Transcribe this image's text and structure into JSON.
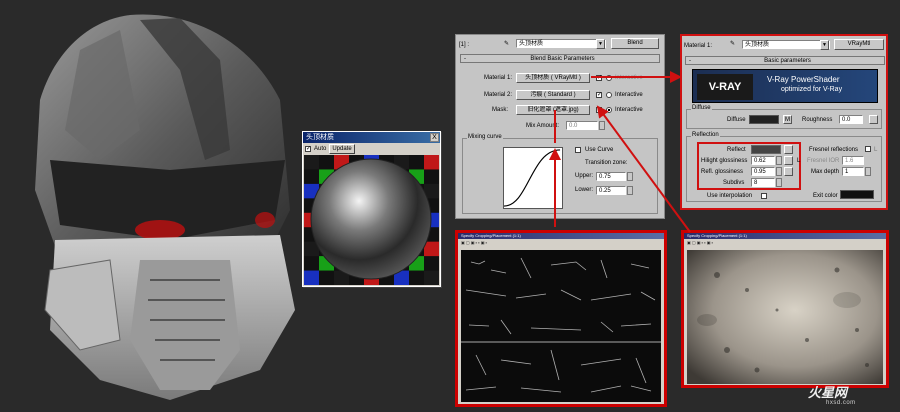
{
  "preview_window": {
    "title": "头顶材质",
    "close": "X",
    "auto_label": "Auto",
    "update_label": "Update"
  },
  "blend_panel": {
    "header_num": "[1] :",
    "material_name": "头顶材质",
    "type_button": "Blend",
    "rollout_title": "Blend Basic Parameters",
    "material1_label": "Material 1:",
    "material1_value": "头顶材质 ( VRayMtl )",
    "material2_label": "Material 2:",
    "material2_value": "污痕 ( Standard )",
    "mask_label": "Mask:",
    "mask_value": "旧化遮罩 (遮罩.jpg)",
    "interactive_label": "Interactive",
    "mix_amount_label": "Mix Amount:",
    "mix_amount_value": "0.0",
    "mixing_curve_label": "Mixing curve",
    "use_curve_label": "Use Curve",
    "transition_zone_label": "Transition zone:",
    "upper_label": "Upper:",
    "upper_value": "0.75",
    "lower_label": "Lower:",
    "lower_value": "0.25"
  },
  "vray_panel": {
    "material_label": "Material 1:",
    "material_name": "头顶材质",
    "type_button": "VRayMtl",
    "rollout_title": "Basic parameters",
    "logo_text": "V-RAY",
    "shader_title": "V-Ray PowerShader",
    "shader_subtitle": "optimized for V-Ray",
    "diffuse_group": "Diffuse",
    "diffuse_label": "Diffuse",
    "diffuse_map": "M",
    "roughness_label": "Roughness",
    "roughness_value": "0.0",
    "reflection_group": "Reflection",
    "reflect_label": "Reflect",
    "hilight_label": "Hilight glossiness",
    "hilight_value": "0.62",
    "hilight_lock": "L",
    "refl_gloss_label": "Refl. glossiness",
    "refl_gloss_value": "0.95",
    "subdivs_label": "Subdivs",
    "subdivs_value": "8",
    "fresnel_label": "Fresnel reflections",
    "fresnel_lock": "L",
    "fresnel_ior_label": "Fresnel IOR",
    "fresnel_ior_value": "1.6",
    "max_depth_label": "Max depth",
    "max_depth_value": "1",
    "exit_color_label": "Exit color",
    "use_interp_label": "Use interpolation"
  },
  "texture_windows": [
    {
      "title": "Specify Cropping/Placement (1:1)"
    },
    {
      "title": "Specify Cropping/Placement (1:1)"
    }
  ],
  "watermark": {
    "brand": "火星网",
    "url": "hxsd.com"
  },
  "colors": {
    "annotation_red": "#d01010",
    "background": "#2a2a2a",
    "panel_gray": "#c5c5c5"
  }
}
